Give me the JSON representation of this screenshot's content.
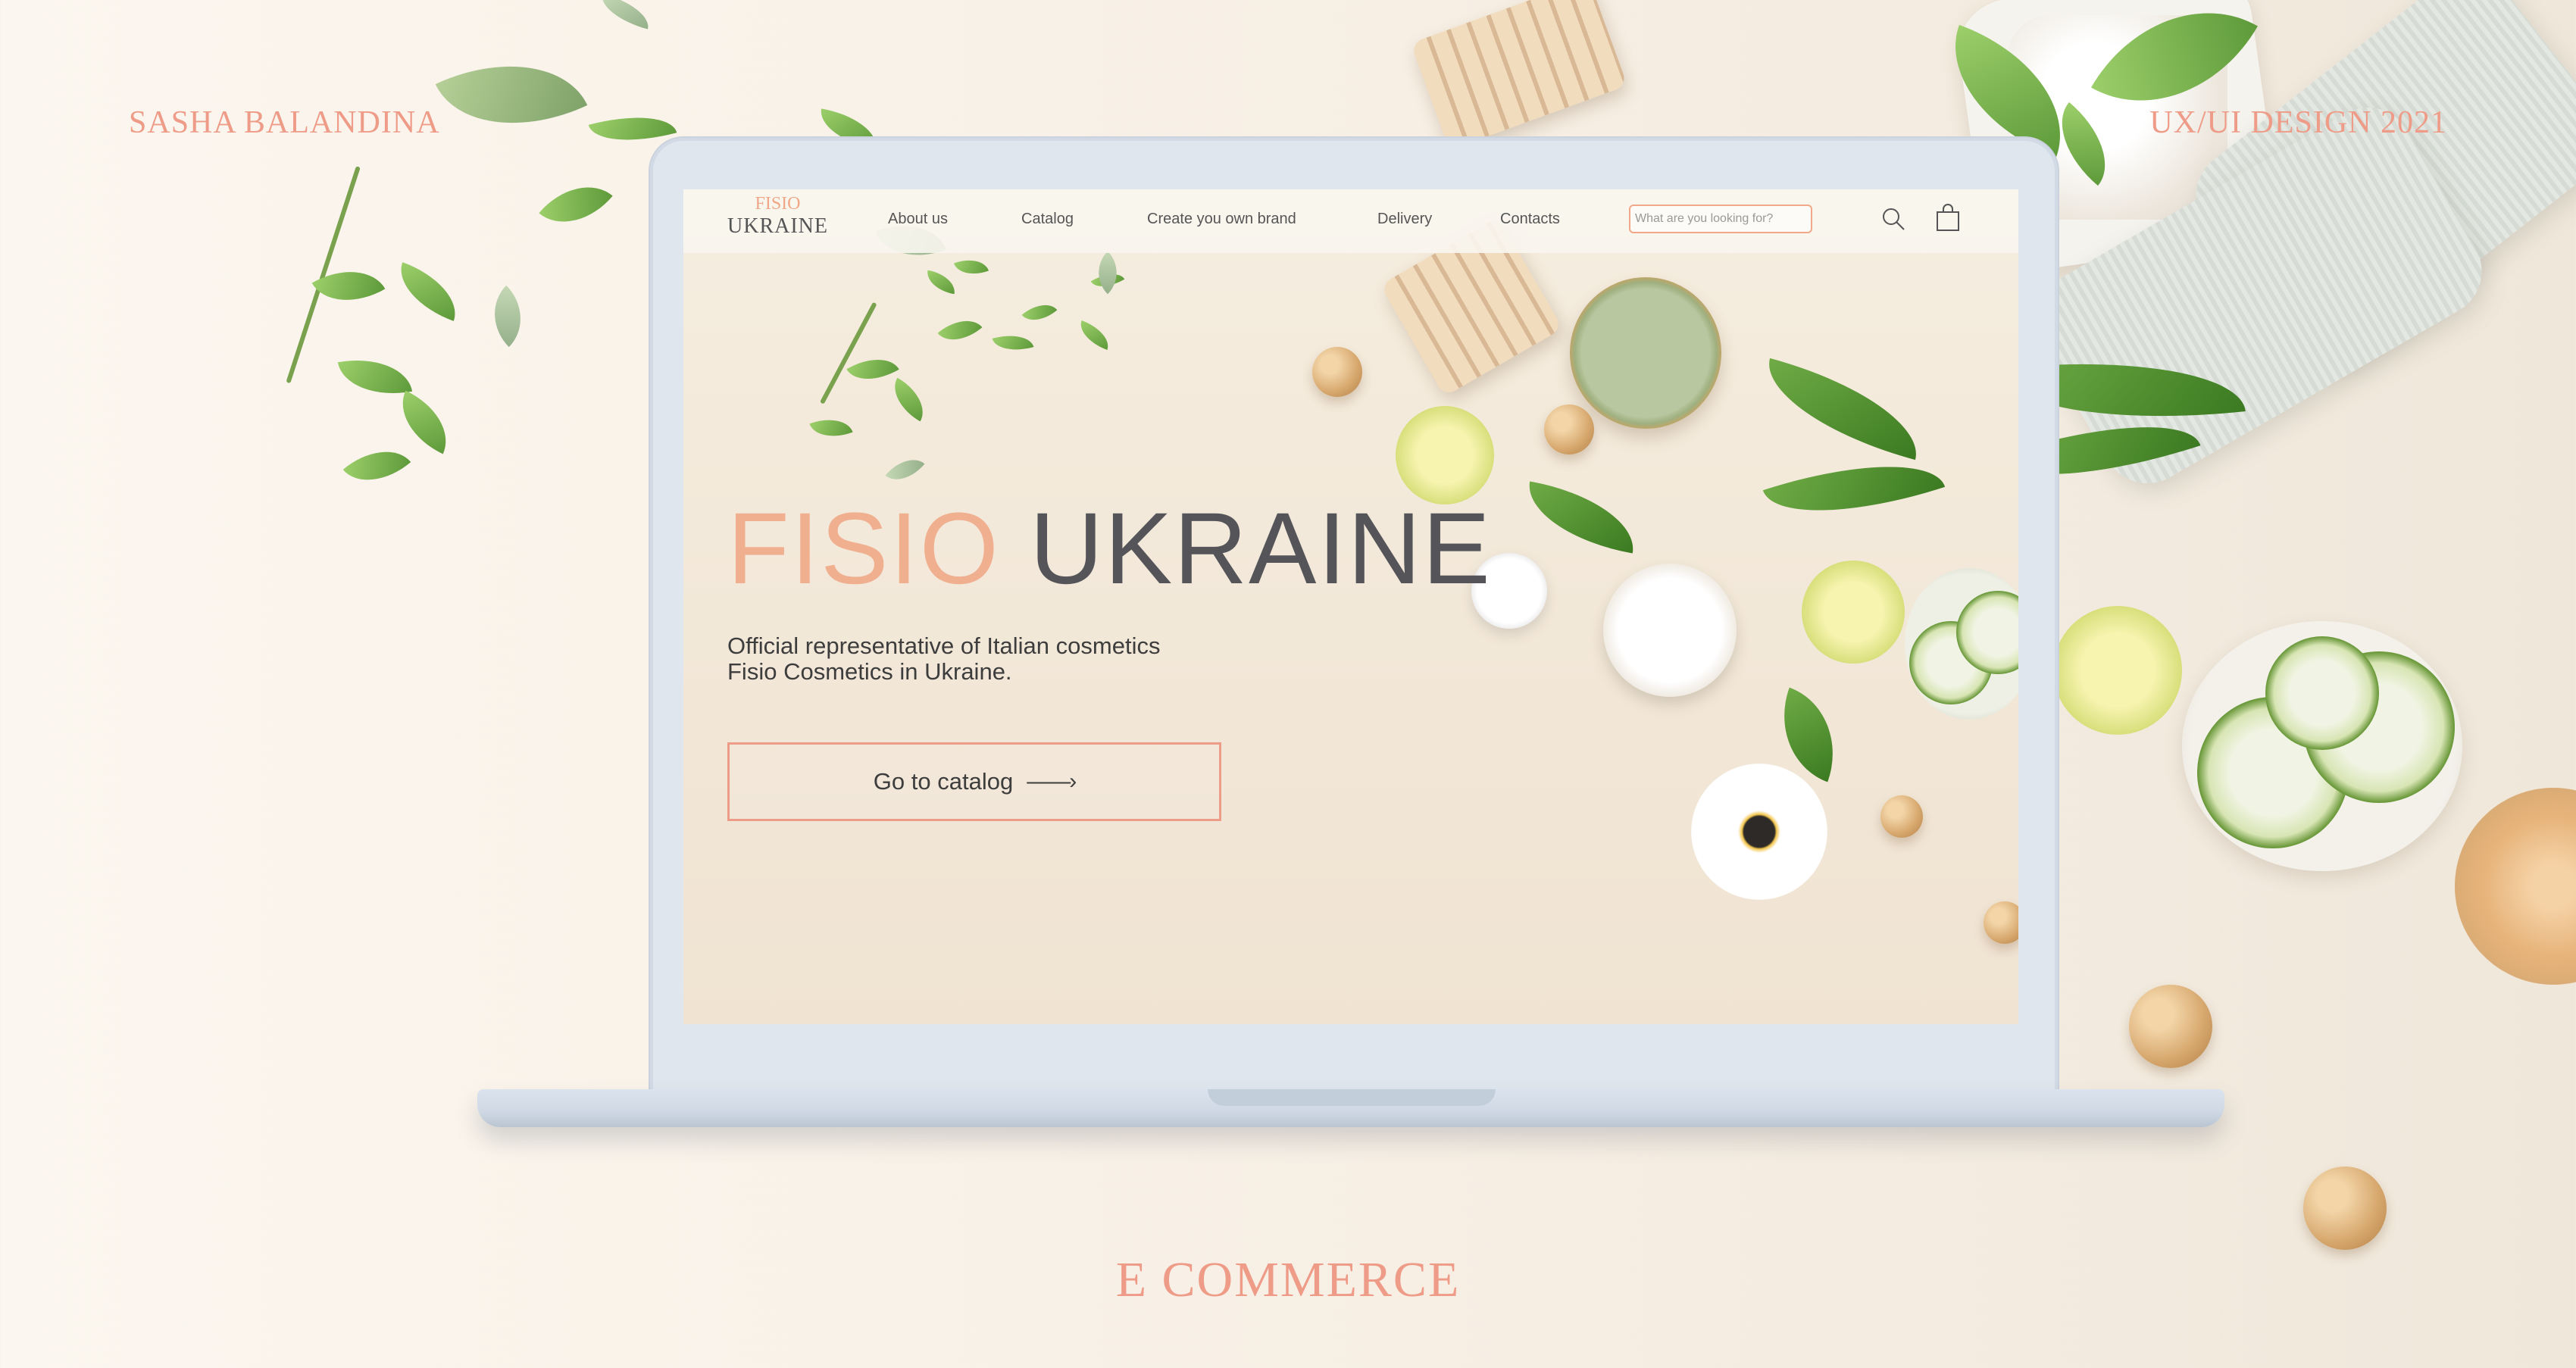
{
  "captions": {
    "author": "SASHA BALANDINA",
    "design_year": "UX/UI DESIGN 2021",
    "footer": "E COMMERCE"
  },
  "site": {
    "logo": {
      "top": "FISIO",
      "bottom": "UKRAINE"
    },
    "nav": [
      {
        "label": "About us"
      },
      {
        "label": "Catalog"
      },
      {
        "label": "Create you own brand"
      },
      {
        "label": "Delivery"
      },
      {
        "label": "Contacts"
      }
    ],
    "search": {
      "placeholder": "What are you looking for?",
      "value": ""
    },
    "hero": {
      "title_part1": "FISIO",
      "title_part2": "UKRAINE",
      "subtitle_line1": "Official representative of Italian cosmetics",
      "subtitle_line2": "Fisio Cosmetics in Ukraine.",
      "cta_label": "Go to catalog",
      "cta_arrow": "——›"
    }
  },
  "colors": {
    "accent_peach": "#f0b090",
    "accent_coral": "#ee9b88",
    "text_dark": "#555559",
    "laptop_frame": "#dfe6ee"
  },
  "icons": {
    "search": "search-icon",
    "cart": "shopping-bag-icon"
  }
}
